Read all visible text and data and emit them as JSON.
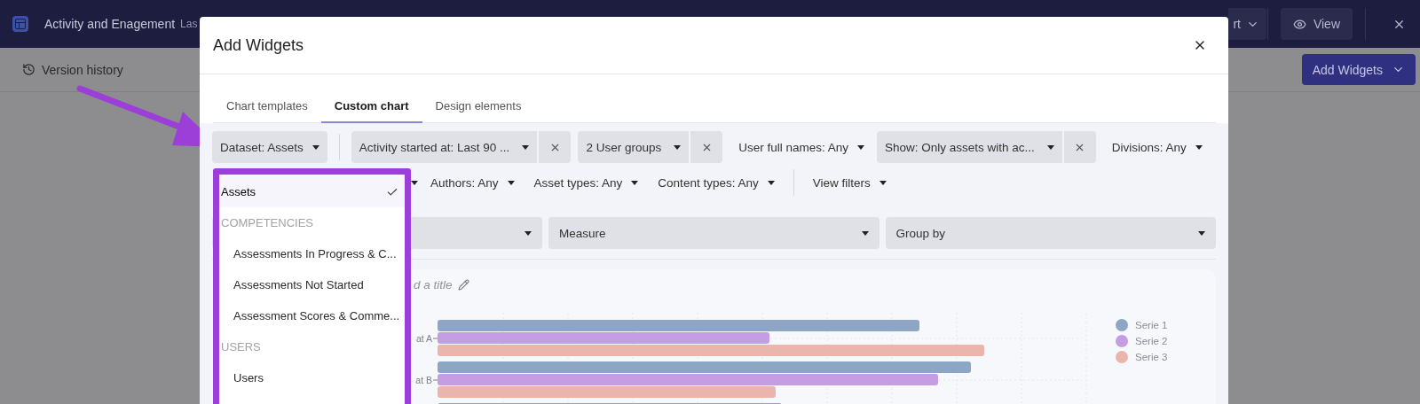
{
  "top_bar": {
    "title": "Activity and Enagement",
    "subtitle": "Las",
    "export_label": "rt",
    "view_label": "View"
  },
  "toolbar": {
    "version_history": "Version history",
    "add_widgets": "Add Widgets"
  },
  "modal": {
    "title": "Add Widgets",
    "tabs": [
      {
        "label": "Chart templates",
        "selected": false
      },
      {
        "label": "Custom chart",
        "selected": true
      },
      {
        "label": "Design elements",
        "selected": false
      }
    ],
    "dataset": "Dataset: Assets",
    "filters": [
      {
        "kind": "removable",
        "label": "Activity started at: Last 90 ..."
      },
      {
        "kind": "removable",
        "label": "2 User groups"
      },
      {
        "kind": "plain",
        "label": "User full names: Any"
      },
      {
        "kind": "removable",
        "label": "Show: Only assets with ac..."
      },
      {
        "kind": "plain",
        "label": "Divisions: Any"
      }
    ],
    "filters_2": [
      {
        "kind": "plain",
        "label": "Authors: Any"
      },
      {
        "kind": "plain",
        "label": "Asset types: Any"
      },
      {
        "kind": "plain",
        "label": "Content types: Any"
      }
    ],
    "view_filters": "View filters",
    "selects": [
      {
        "label": "Measure"
      },
      {
        "label": "Group by"
      }
    ],
    "chart": {
      "title_placeholder": "d a title",
      "categories": [
        "at A",
        "at B"
      ],
      "legend": [
        {
          "name": "Serie 1",
          "color": "#8ea6c5"
        },
        {
          "name": "Serie 2",
          "color": "#c49de3"
        },
        {
          "name": "Serie 3",
          "color": "#e9b5ad"
        }
      ]
    },
    "dataset_menu": [
      {
        "kind": "option",
        "label": "Assets",
        "selected": true
      },
      {
        "kind": "header",
        "label": "COMPETENCIES"
      },
      {
        "kind": "option",
        "label": "Assessments In Progress & C...",
        "selected": false
      },
      {
        "kind": "option",
        "label": "Assessments Not Started",
        "selected": false
      },
      {
        "kind": "option",
        "label": "Assessment Scores & Comme...",
        "selected": false
      },
      {
        "kind": "header",
        "label": "USERS"
      },
      {
        "kind": "option",
        "label": "Users",
        "selected": false
      }
    ]
  }
}
